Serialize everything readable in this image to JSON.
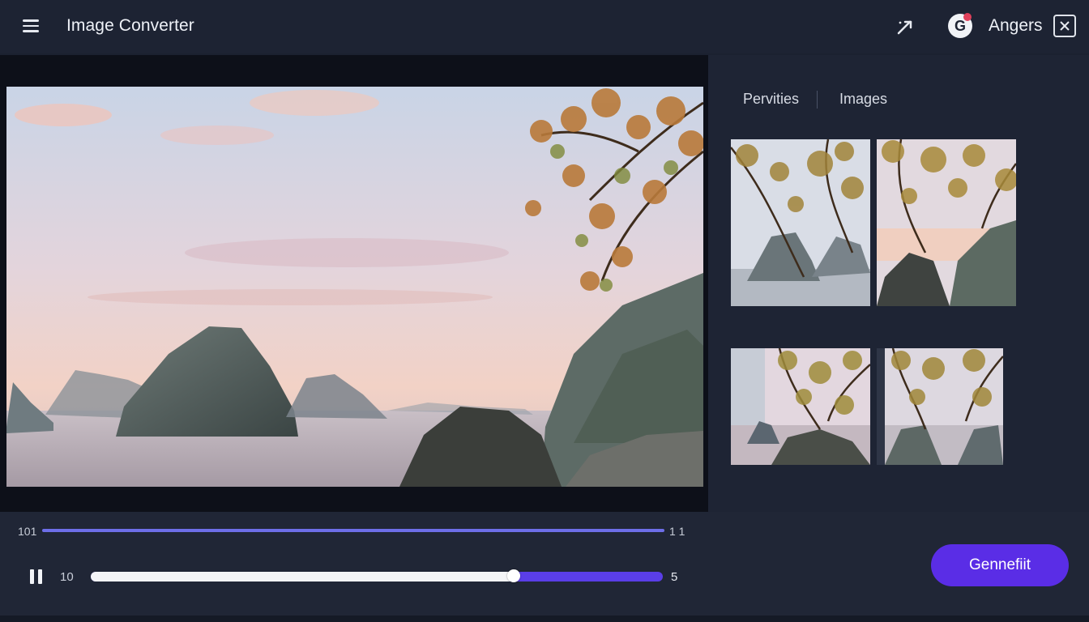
{
  "header": {
    "title": "Image Converter",
    "user_name": "Angers",
    "avatar_letter": "G"
  },
  "panel": {
    "tabs": [
      {
        "label": "Pervities"
      },
      {
        "label": "Images"
      }
    ]
  },
  "player": {
    "time_start": "101",
    "time_end": "1 1",
    "volume_label": "10",
    "slider_max": "5",
    "slider_progress": 0.74,
    "generate_label": "Gennefiit"
  },
  "colors": {
    "accent": "#5a2de6",
    "timeline": "#6d6ee8",
    "background": "#1b2130"
  }
}
